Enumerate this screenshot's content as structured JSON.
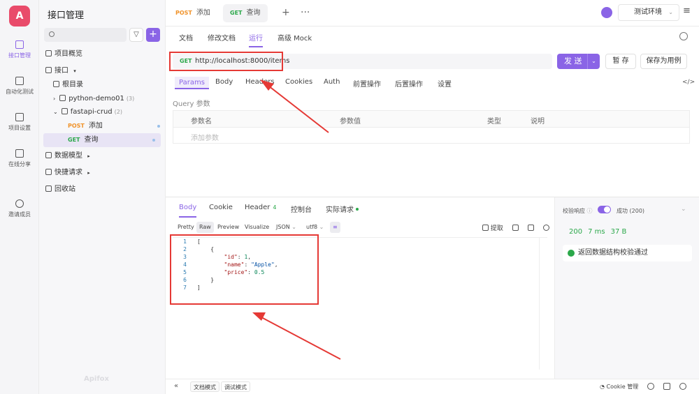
{
  "app": {
    "logo_letter": "A",
    "module_title": "接口管理",
    "watermark": "Apifox"
  },
  "rail": [
    {
      "label": "接口管理",
      "icon": "api-icon"
    },
    {
      "label": "自动化测试",
      "icon": "test-icon"
    },
    {
      "label": "项目设置",
      "icon": "settings-icon"
    },
    {
      "label": "在线分享",
      "icon": "share-icon"
    },
    {
      "label": "邀请成员",
      "icon": "invite-icon"
    }
  ],
  "tree": {
    "overview": "项目概览",
    "api_root": "接口",
    "root_dir": "根目录",
    "folders": [
      {
        "name": "python-demo01",
        "count": "(3)"
      },
      {
        "name": "fastapi-crud",
        "count": "(2)"
      }
    ],
    "endpoints": [
      {
        "method": "POST",
        "name": "添加"
      },
      {
        "method": "GET",
        "name": "查询"
      }
    ],
    "data_models": "数据模型",
    "quick_requests": "快捷请求",
    "recycle_bin": "回收站"
  },
  "tabs": [
    {
      "method": "POST",
      "name": "添加"
    },
    {
      "method": "GET",
      "name": "查询"
    }
  ],
  "environment": "测试环境",
  "subtabs": [
    "文档",
    "修改文档",
    "运行",
    "高级 Mock"
  ],
  "request": {
    "method": "GET",
    "url": "http://localhost:8000/items",
    "send_label": "发 送",
    "save_label": "暂 存",
    "save_case_label": "保存为用例"
  },
  "param_tabs": [
    "Params",
    "Body",
    "Headers",
    "Cookies",
    "Auth",
    "前置操作",
    "后置操作",
    "设置"
  ],
  "query": {
    "section": "Query 参数",
    "columns": [
      "参数名",
      "参数值",
      "类型",
      "说明"
    ],
    "add_placeholder": "添加参数"
  },
  "response": {
    "tabs": [
      {
        "label": "Body",
        "badge": ""
      },
      {
        "label": "Cookie",
        "badge": ""
      },
      {
        "label": "Header",
        "badge": "4"
      },
      {
        "label": "控制台",
        "badge": ""
      },
      {
        "label": "实际请求",
        "badge": ""
      }
    ],
    "formats": [
      "Pretty",
      "Raw",
      "Preview",
      "Visualize",
      "JSON",
      "utf8"
    ],
    "extract_label": "提取",
    "code_lines": [
      {
        "n": "1",
        "text": "["
      },
      {
        "n": "2",
        "text": "    {"
      },
      {
        "n": "3",
        "key": "\"id\"",
        "val": "1",
        "type": "num",
        "comma": ","
      },
      {
        "n": "4",
        "key": "\"name\"",
        "val": "\"Apple\"",
        "type": "str",
        "comma": ","
      },
      {
        "n": "5",
        "key": "\"price\"",
        "val": "0.5",
        "type": "num",
        "comma": ""
      },
      {
        "n": "6",
        "text": "    }"
      },
      {
        "n": "7",
        "text": "]"
      }
    ]
  },
  "validation": {
    "label": "校验响应",
    "status": "成功 (200)",
    "code": "200",
    "time": "7 ms",
    "size": "37 B",
    "message": "返回数据结构校验通过"
  },
  "bottom": {
    "doc_mode": "文档模式",
    "debug_mode": "调试模式",
    "cookie_manage": "Cookie 管理"
  },
  "colors": {
    "accent": "#8a64e6",
    "get": "#2ba84a",
    "post": "#f0932b",
    "annotation": "#e53935"
  }
}
